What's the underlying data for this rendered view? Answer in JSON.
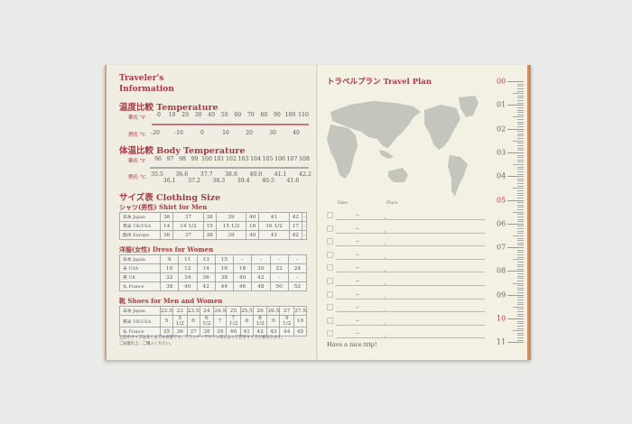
{
  "left_page": {
    "title_line1": "Traveler's",
    "title_line2": "Information",
    "temperature": {
      "heading": "温度比較  Temperature",
      "f_label": "華氏 °F",
      "c_label": "摂氏 °C",
      "f_values": [
        "0",
        "10",
        "20",
        "30",
        "40",
        "50",
        "60",
        "70",
        "80",
        "90",
        "100",
        "110"
      ],
      "c_values": [
        "-20",
        "-10",
        "0",
        "10",
        "20",
        "30",
        "40"
      ]
    },
    "body_temperature": {
      "heading": "体温比較  Body Temperature",
      "f_label": "華氏 °F",
      "c_label": "摂氏 °C",
      "f_values": [
        "96",
        "97",
        "98",
        "99",
        "100",
        "101",
        "102",
        "103",
        "104",
        "105",
        "106",
        "107",
        "108"
      ],
      "c_values": [
        "35.5",
        "36.1",
        "36.6",
        "37.2",
        "37.7",
        "38.3",
        "38.8",
        "39.4",
        "40.0",
        "40.5",
        "41.1",
        "41.6",
        "42.2"
      ]
    },
    "clothing_heading": "サイズ表  Clothing Size",
    "shirt": {
      "heading": "シャツ(男性)  Shirt for Men",
      "rows": [
        [
          "日本  Japan",
          "36",
          "37",
          "38",
          "39",
          "40",
          "41",
          "42",
          "-"
        ],
        [
          "英米  UK/USA",
          "14",
          "14 1/2",
          "15",
          "15 1/2",
          "16",
          "16 1/2",
          "17",
          "-"
        ],
        [
          "欧州  Europe",
          "36",
          "37",
          "38",
          "39",
          "40",
          "41",
          "42",
          "-"
        ]
      ]
    },
    "dress": {
      "heading": "洋服(女性)  Dress for Women",
      "rows": [
        [
          "日本  Japan",
          "9",
          "11",
          "13",
          "15",
          "-",
          "-",
          "-",
          "-"
        ],
        [
          "米  USA",
          "10",
          "12",
          "14",
          "16",
          "18",
          "20",
          "22",
          "24"
        ],
        [
          "英  UK",
          "32",
          "34",
          "36",
          "38",
          "40",
          "42",
          "-",
          "-"
        ],
        [
          "仏  France",
          "38",
          "40",
          "42",
          "44",
          "46",
          "48",
          "50",
          "52"
        ]
      ]
    },
    "shoes": {
      "heading": "靴  Shoes for Men and Women",
      "rows": [
        [
          "日本  Japan",
          "22.5",
          "23",
          "23.5",
          "24",
          "24.5",
          "25",
          "25.5",
          "26",
          "26.5",
          "27",
          "27.5"
        ],
        [
          "英米  UK/USA",
          "5",
          "5 1/2",
          "6",
          "6 1/2",
          "7",
          "7 1/2",
          "8",
          "8 1/2",
          "9",
          "9 1/2",
          "10"
        ],
        [
          "仏  France",
          "35",
          "36",
          "37",
          "38",
          "39",
          "40",
          "41",
          "42",
          "43",
          "44",
          "45"
        ]
      ]
    },
    "note_line1": "上記のサイズはあくまでも目安です。ブランド・デザイン等によって若干サイズが異なります。",
    "note_line2": "ご試着の上、ご購入ください。"
  },
  "right_page": {
    "title": "トラベルプラン  Travel Plan",
    "date_label": "Date",
    "place_label": "Place",
    "row_count": 10,
    "footer": "Have a nice trip!",
    "hours": [
      "00",
      "01",
      "02",
      "03",
      "04",
      "05",
      "06",
      "07",
      "08",
      "09",
      "10",
      "11"
    ],
    "highlight_hours": [
      "00",
      "05",
      "10"
    ]
  },
  "colors": {
    "accent_red": "#a83a44",
    "map_gray": "#c4c5bc",
    "paper": "#f3f1e3"
  }
}
